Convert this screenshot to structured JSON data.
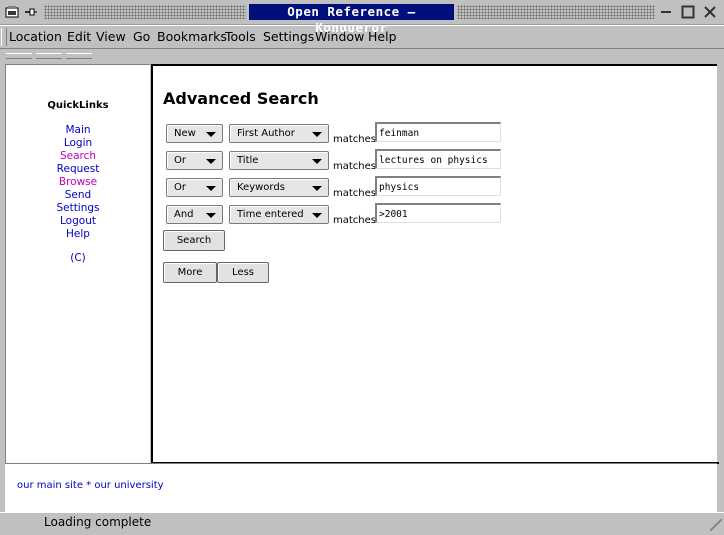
{
  "window": {
    "title": "Open Reference – Konqueror"
  },
  "menu": [
    "Location",
    "Edit",
    "View",
    "Go",
    "Bookmarks",
    "Tools",
    "Settings",
    "Window",
    "Help"
  ],
  "quicklinks": {
    "title": "QuickLinks",
    "items": [
      {
        "label": "Main",
        "visited": false
      },
      {
        "label": "Login",
        "visited": false
      },
      {
        "label": "Search",
        "visited": true
      },
      {
        "label": "Request",
        "visited": false
      },
      {
        "label": "Browse",
        "visited": true
      },
      {
        "label": "Send",
        "visited": false
      },
      {
        "label": "Settings",
        "visited": false
      },
      {
        "label": "Logout",
        "visited": false
      },
      {
        "label": "Help",
        "visited": false
      }
    ],
    "copyright": "(C)"
  },
  "search": {
    "heading": "Advanced Search",
    "matches_label": "matches",
    "rows": [
      {
        "op": "New",
        "field": "First Author",
        "value": "feinman"
      },
      {
        "op": "Or",
        "field": "Title",
        "value": "lectures on physics"
      },
      {
        "op": "Or",
        "field": "Keywords",
        "value": "physics"
      },
      {
        "op": "And",
        "field": "Time entered",
        "value": ">2001"
      }
    ],
    "search_button": "Search",
    "more_button": "More",
    "less_button": "Less"
  },
  "footer": {
    "links": "our main site * our university"
  },
  "status": {
    "text": "Loading complete"
  },
  "colors": {
    "title_bg": "#00107a",
    "link": "#0000c8",
    "visited_link": "#c000c0",
    "chrome": "#c0c0c0"
  }
}
